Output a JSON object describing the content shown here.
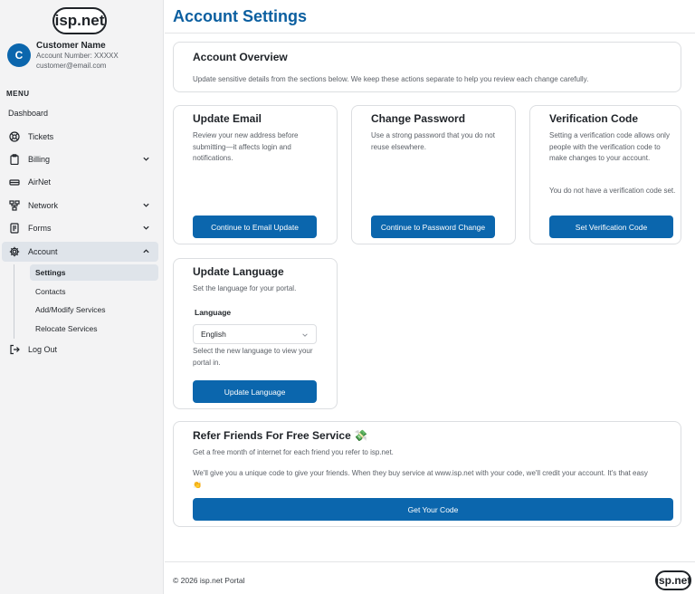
{
  "brand": {
    "logo_text": "isp.net"
  },
  "profile": {
    "avatar_letter": "C",
    "name": "Customer Name",
    "account_number": "Account Number: XXXXX",
    "email": "customer@email.com"
  },
  "sidebar": {
    "menu_heading": "MENU",
    "items": [
      {
        "label": "Dashboard",
        "icon": "none"
      },
      {
        "label": "Tickets",
        "icon": "lifebuoy-icon"
      },
      {
        "label": "Billing",
        "icon": "clipboard-icon",
        "expandable": true
      },
      {
        "label": "AirNet",
        "icon": "router-icon"
      },
      {
        "label": "Network",
        "icon": "network-icon",
        "expandable": true
      },
      {
        "label": "Forms",
        "icon": "form-icon",
        "expandable": true
      },
      {
        "label": "Account",
        "icon": "gear-icon",
        "expandable": true,
        "expanded": true
      },
      {
        "label": "Log Out",
        "icon": "logout-icon"
      }
    ],
    "account_subitems": [
      {
        "label": "Settings",
        "active": true
      },
      {
        "label": "Contacts"
      },
      {
        "label": "Add/Modify Services"
      },
      {
        "label": "Relocate Services"
      }
    ]
  },
  "main": {
    "title": "Account Settings",
    "overview": {
      "title": "Account Overview",
      "text": "Update sensitive details from the sections below. We keep these actions separate to help you review each change carefully."
    },
    "update_email": {
      "title": "Update Email",
      "text": "Review your new address before submitting—it affects login and notifications.",
      "button": "Continue to Email Update"
    },
    "change_password": {
      "title": "Change Password",
      "text": "Use a strong password that you do not reuse elsewhere.",
      "button": "Continue to Password Change"
    },
    "verification_code": {
      "title": "Verification Code",
      "text": "Setting a verification code allows only people with the verification code to make changes to your account.",
      "status": "You do not have a verification code set.",
      "button": "Set Verification Code"
    },
    "update_language": {
      "title": "Update Language",
      "text": "Set the language for your portal.",
      "field_label": "Language",
      "selected": "English",
      "help": "Select the new language to view your portal in.",
      "button": "Update Language"
    },
    "refer": {
      "title": "Refer Friends For Free Service 💸",
      "text1": "Get a free month of internet for each friend you refer to isp.net.",
      "text2": "We'll give you a unique code to give your friends. When they buy service at www.isp.net with your code, we'll credit your account. It's that easy 👏",
      "button": "Get Your Code"
    }
  },
  "footer": {
    "copyright": "© 2026 isp.net Portal",
    "logo_text": "isp.net"
  },
  "colors": {
    "accent": "#0b66ad",
    "title": "#0b5fa0",
    "sidebar_bg": "#f3f3f4"
  }
}
